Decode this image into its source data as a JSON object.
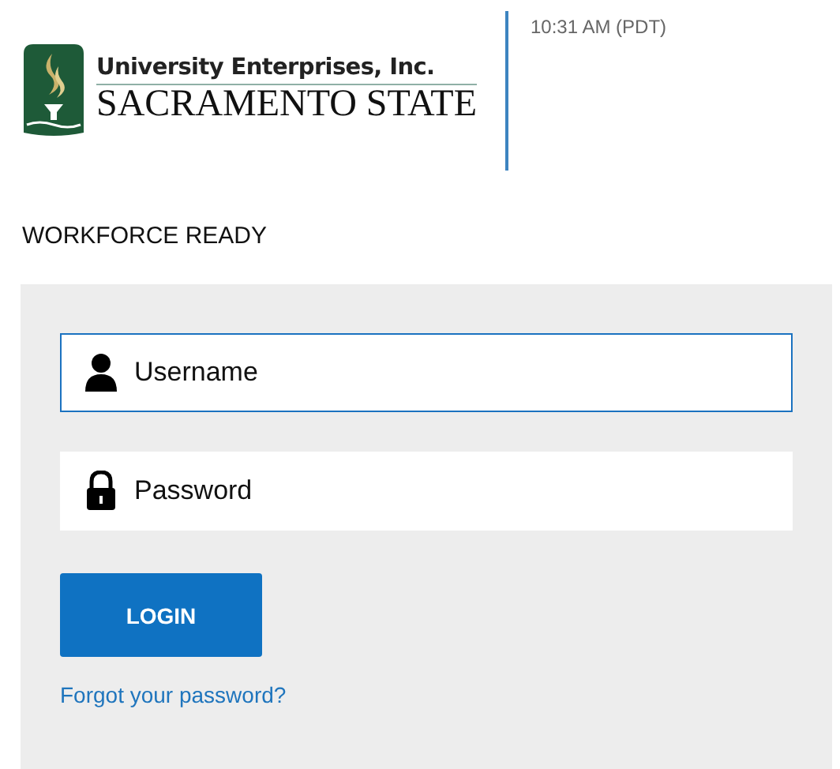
{
  "header": {
    "logo": {
      "line_1": "University Enterprises, Inc.",
      "line_2": "SACRAMENTO STATE"
    },
    "time": "10:31 AM (PDT)"
  },
  "title": "WORKFORCE READY",
  "login_form": {
    "fields": [
      {
        "kind": "user",
        "placeholder": "Username",
        "focused": true
      },
      {
        "kind": "lock",
        "placeholder": "Password",
        "focused": false
      }
    ],
    "submit": "LOGIN",
    "forgot_link": "Forgot your password?"
  }
}
